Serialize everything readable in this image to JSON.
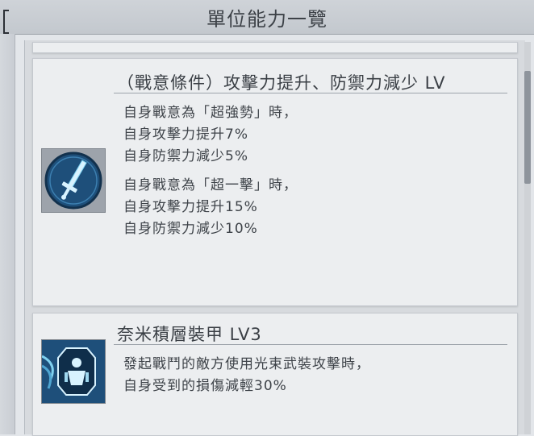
{
  "header": {
    "title": "單位能力一覽"
  },
  "skills": [
    {
      "title": "（戰意條件）攻擊力提升、防禦力減少 LV",
      "icon": "sword-icon",
      "lines": [
        "自身戰意為「超強勢」時，",
        "自身攻擊力提升7%",
        "自身防禦力減少5%",
        "",
        "自身戰意為「超一擊」時，",
        "自身攻擊力提升15%",
        "自身防禦力減少10%"
      ]
    },
    {
      "title": "奈米積層裝甲 LV3",
      "icon": "armor-icon",
      "lines": [
        "發起戰鬥的敵方使用光束武裝攻擊時，",
        "自身受到的損傷減輕30%"
      ]
    }
  ],
  "colors": {
    "icon_bg": "#1e4f7a",
    "icon_accent": "#7fd1f0"
  }
}
